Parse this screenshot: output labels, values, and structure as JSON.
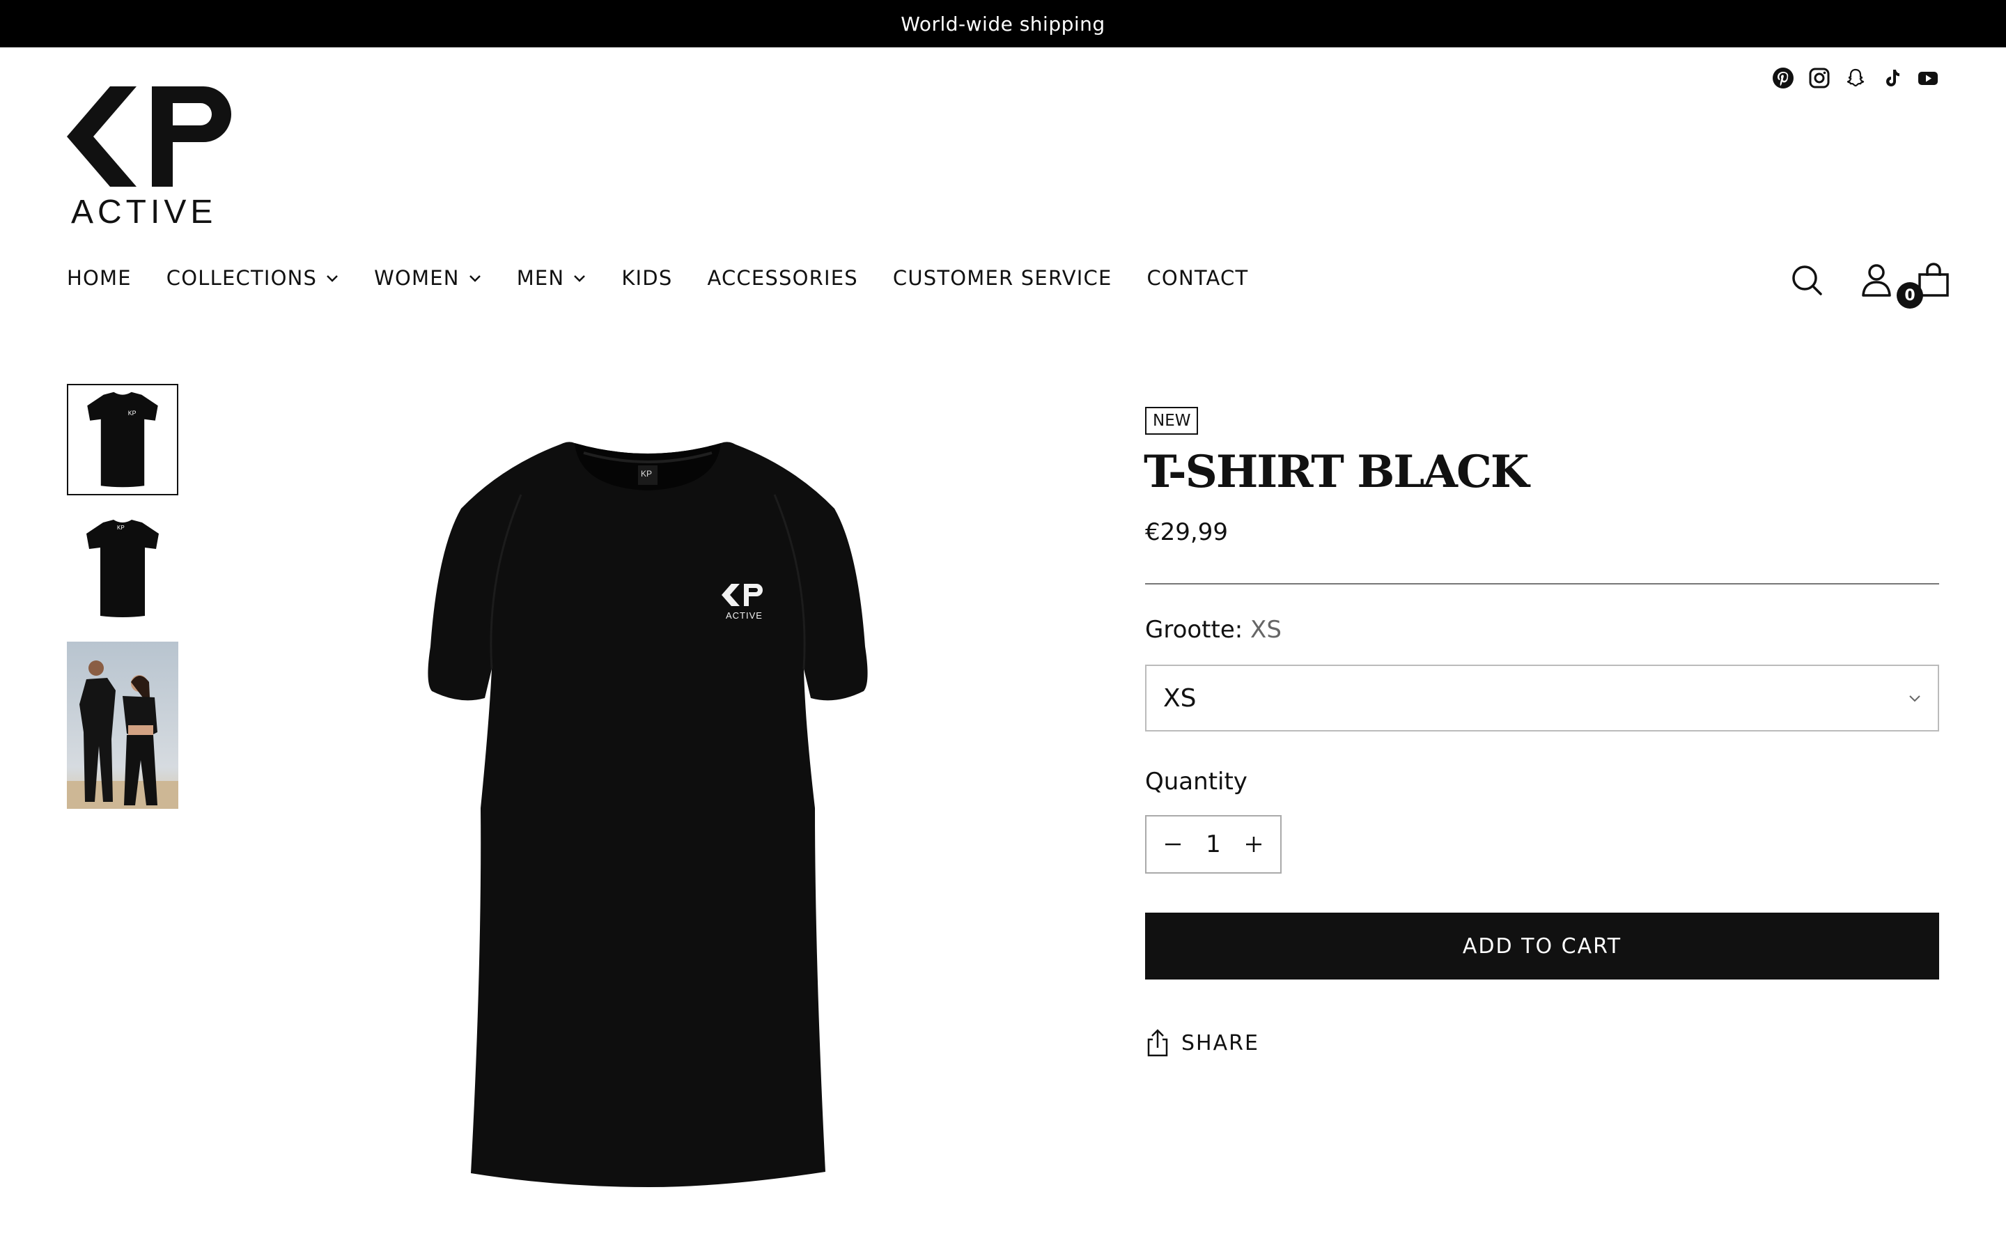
{
  "announcement": {
    "text": "World-wide shipping"
  },
  "brand": {
    "logo_text": "ACTIVE",
    "logo_monogram": "KP"
  },
  "social": {
    "icons": [
      "pinterest-icon",
      "instagram-icon",
      "snapchat-icon",
      "tiktok-icon",
      "youtube-icon"
    ]
  },
  "nav": {
    "items": [
      {
        "label": "HOME",
        "has_dropdown": false
      },
      {
        "label": "COLLECTIONS",
        "has_dropdown": true
      },
      {
        "label": "WOMEN",
        "has_dropdown": true
      },
      {
        "label": "MEN",
        "has_dropdown": true
      },
      {
        "label": "KIDS",
        "has_dropdown": false
      },
      {
        "label": "ACCESSORIES",
        "has_dropdown": false
      },
      {
        "label": "CUSTOMER SERVICE",
        "has_dropdown": false
      },
      {
        "label": "CONTACT",
        "has_dropdown": false
      }
    ]
  },
  "header": {
    "cart_count": "0",
    "icons": [
      "search-icon",
      "account-icon",
      "cart-icon"
    ]
  },
  "gallery": {
    "selected_index": 0,
    "thumbnail_count": 3
  },
  "product": {
    "badge": "NEW",
    "title": "T-SHIRT BLACK",
    "price": "€29,99",
    "size_label": "Grootte:",
    "size_value": "XS",
    "size_selected": "XS",
    "quantity_label": "Quantity",
    "quantity": "1",
    "add_to_cart": "ADD TO CART",
    "share_label": "SHARE"
  },
  "colors": {
    "announcement_bg": "#000000",
    "button_bg": "#111111",
    "text": "#111111"
  }
}
